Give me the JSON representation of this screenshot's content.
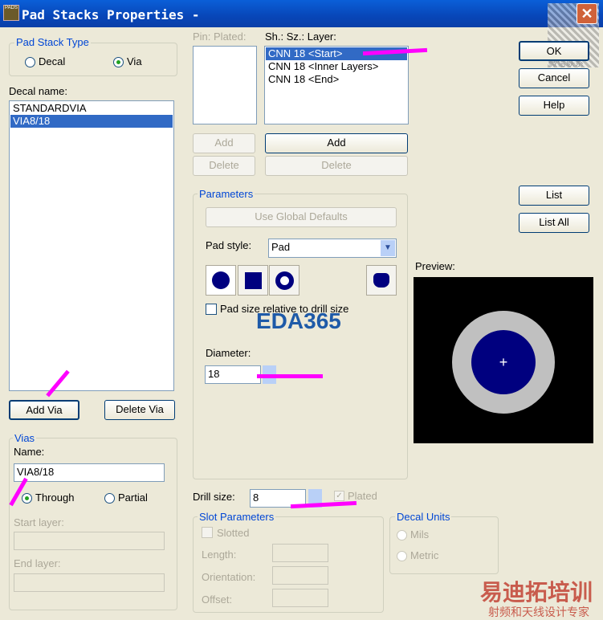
{
  "window": {
    "title": "Pad Stacks Properties -",
    "icon_text": "PADS"
  },
  "pad_stack_type": {
    "label": "Pad Stack Type",
    "options": [
      "Decal",
      "Via"
    ],
    "selected": "Via"
  },
  "decal_name": {
    "label": "Decal name:",
    "items": [
      "STANDARDVIA",
      "VIA8/18"
    ],
    "selected": "VIA8/18"
  },
  "buttons": {
    "add_via": "Add Via",
    "delete_via": "Delete Via",
    "ok": "OK",
    "cancel": "Cancel",
    "help": "Help",
    "list": "List",
    "list_all": "List All",
    "add_left": "Add",
    "delete_left": "Delete",
    "add_right": "Add",
    "delete_right": "Delete",
    "use_global": "Use Global Defaults"
  },
  "vias": {
    "label": "Vias",
    "name_label": "Name:",
    "name_value": "VIA8/18",
    "through": "Through",
    "partial": "Partial",
    "selected": "Through",
    "start_layer": "Start layer:",
    "end_layer": "End layer:"
  },
  "pin_header": "Pin: Plated:",
  "layer_header": "Sh.: Sz.: Layer:",
  "layers": [
    "CNN 18 <Start>",
    "CNN 18 <Inner Layers>",
    "CNN 18 <End>"
  ],
  "parameters": {
    "label": "Parameters",
    "pad_style_label": "Pad style:",
    "pad_style_value": "Pad",
    "relative_label": "Pad size relative to drill size",
    "diameter_label": "Diameter:",
    "diameter_value": "18"
  },
  "drill": {
    "label": "Drill size:",
    "value": "8",
    "plated": "Plated"
  },
  "slot": {
    "label": "Slot Parameters",
    "slotted": "Slotted",
    "length": "Length:",
    "orientation": "Orientation:",
    "offset": "Offset:"
  },
  "decal_units": {
    "label": "Decal Units",
    "mils": "Mils",
    "metric": "Metric",
    "selected": "Mils"
  },
  "preview": {
    "label": "Preview:"
  },
  "watermarks": {
    "eda": "EDA365",
    "cn": "易迪拓培训",
    "cn_sub": "射频和天线设计专家",
    "qr": "微信联系"
  }
}
